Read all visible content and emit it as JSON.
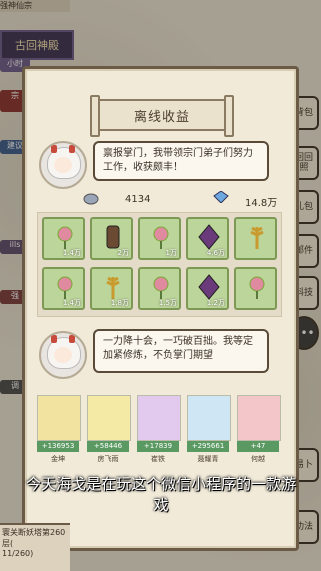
{
  "top_banner": "古回神殿",
  "top_label": "强神仙宗",
  "panel": {
    "title": "离线收益",
    "report_text": "禀报掌门，我带领宗门弟子们努力工作，收获颇丰！",
    "res1_value": "4134",
    "res2_value": "14.8万",
    "items": [
      {
        "name": "flower",
        "qty": "1.4万",
        "icon": "flower-icon",
        "color": "#e08aa0"
      },
      {
        "name": "wood",
        "qty": "2万",
        "icon": "wood-log-icon",
        "color": "#6b4a33"
      },
      {
        "name": "flower2",
        "qty": "1万",
        "icon": "flower-icon",
        "color": "#e08aa0"
      },
      {
        "name": "crystal",
        "qty": "4.6万",
        "icon": "crystal-icon",
        "color": "#6a3a7a"
      },
      {
        "name": "wheat",
        "qty": "",
        "icon": "wheat-icon",
        "color": "#c99b2e"
      },
      {
        "name": "flower3",
        "qty": "1.4万",
        "icon": "flower-icon",
        "color": "#e08aa0"
      },
      {
        "name": "wheat2",
        "qty": "1.8万",
        "icon": "wheat-icon",
        "color": "#c99b2e"
      },
      {
        "name": "flower4",
        "qty": "1.5万",
        "icon": "flower-icon",
        "color": "#e08aa0"
      },
      {
        "name": "crystal2",
        "qty": "1.2万",
        "icon": "crystal-icon",
        "color": "#6a3a7a"
      },
      {
        "name": "flower5",
        "qty": "",
        "icon": "flower-icon",
        "color": "#e08aa0"
      }
    ],
    "motto": "一力降十会，一巧破百拙。我等定加紧修炼，不负掌门期望",
    "chars": [
      {
        "val": "+136953",
        "name": "金坤",
        "color": "#f2e3a0"
      },
      {
        "val": "+58446",
        "name": "房飞雨",
        "color": "#f4eaa6"
      },
      {
        "val": "+17839",
        "name": "崔铁",
        "color": "#e2c9ee"
      },
      {
        "val": "+295661",
        "name": "聂耀青",
        "color": "#cfe6f5"
      },
      {
        "val": "+47",
        "name": "何越",
        "color": "#f3c7c9"
      }
    ]
  },
  "subtitle": "今天海戈是在玩这个微信小程序的一款游戏",
  "right_buttons": [
    "背包",
    "回回照",
    "礼包",
    "邮件",
    "科技",
    "",
    "易卜",
    "功法"
  ],
  "left_badges": [
    "小时",
    "宗",
    "建议",
    "ills",
    "强",
    "调"
  ],
  "bottom_left": {
    "line1": "寰关断妖塔第260层(",
    "line2": "11/260)"
  }
}
